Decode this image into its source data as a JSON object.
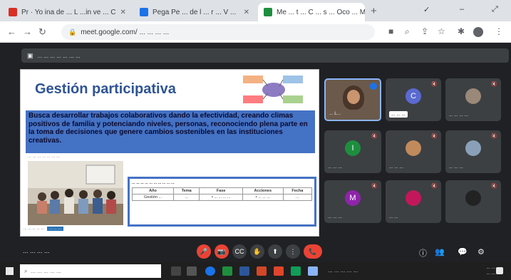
{
  "browser": {
    "tabs": [
      {
        "title": "Pr · Yo ina de ... L ...in ve ... C",
        "active": false,
        "color": "#d93025"
      },
      {
        "title": "Pega Pe ... de l ... r ... V ...",
        "active": false,
        "color": "#1a73e8"
      },
      {
        "title": "Me ... t ... C ... s ... Oco ... M...",
        "active": false,
        "color": "#1e8e3e"
      }
    ],
    "recording_dot": "#d93025",
    "new_tab": "+",
    "window_controls": [
      "✓",
      "–",
      "⤢"
    ],
    "url": "meet.google.com/ ... ... ... ..."
  },
  "meet": {
    "presenter_label": "... ... ...  ... ... ... ...",
    "slide": {
      "title": "Gestión participativa",
      "body": "Busca desarrollar trabajos colaborativos dando la efectividad, creando climas positivos de familia y potenciando niveles, personas, reconociendo plena parte en la toma de decisiones que genere cambios sostenibles en las instituciones creativas.",
      "caption": "... ... ... ... ... ... ...",
      "photo_caption": "... ... ... ... ...",
      "photo_caption_link": "... ... ...",
      "table": {
        "caption": "... ... ... ... ... ... ... ... ... ...",
        "headers": [
          "Año",
          "Tema",
          "Fase",
          "Acciones",
          "Fecha"
        ],
        "rows": [
          [
            "Gestión ...",
            "...",
            "• ... ... ... ...",
            "• ... ... ...",
            "..."
          ]
        ]
      }
    },
    "participants": [
      {
        "name": "... L...",
        "initial": "",
        "color": "#a0785a"
      },
      {
        "name": "... ... ...",
        "initial": "C",
        "color": "#5b6ad1"
      },
      {
        "name": "... ... ... ...",
        "initial": "",
        "color": "#9a8878"
      },
      {
        "name": "... ... ...",
        "initial": "I",
        "color": "#1e8e3e"
      },
      {
        "name": "... ... ...",
        "initial": "",
        "color": "#c08a5c"
      },
      {
        "name": "... ... ...",
        "initial": "",
        "color": "#8aa0b8"
      },
      {
        "name": "... ... ...",
        "initial": "M",
        "color": "#8e24aa"
      },
      {
        "name": "... ...",
        "initial": "",
        "color": "#c2185b"
      },
      {
        "name": "",
        "initial": "",
        "color": "#222222"
      }
    ],
    "meeting_code": "... ... ... ...",
    "controls": [
      "🎤",
      "📷",
      "CC",
      "✋",
      "⬆",
      "⋮",
      "📞"
    ],
    "right_tools": [
      "ⓘ",
      "👥",
      "💬",
      "⚙"
    ]
  },
  "taskbar": {
    "search_placeholder": "... ... ... ... ...",
    "clock_time": "... ...",
    "clock_date": "... ...",
    "tray": "...  ...  ...  ...  ..."
  }
}
